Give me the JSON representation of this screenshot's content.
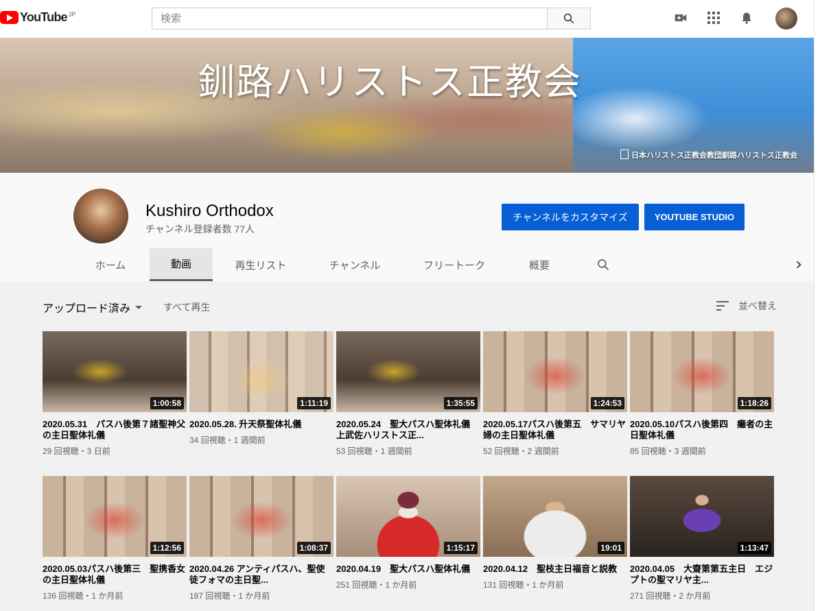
{
  "header": {
    "logo_text": "YouTube",
    "region": "JP",
    "search_placeholder": "検索"
  },
  "banner": {
    "title": "釧路ハリストス正教会",
    "credit": "日本ハリストス正教会教団釧路ハリストス正教会"
  },
  "channel": {
    "name": "Kushiro Orthodox",
    "subscribers": "チャンネル登録者数 77人",
    "customize_label": "チャンネルをカスタマイズ",
    "studio_label": "YOUTUBE STUDIO"
  },
  "tabs": [
    {
      "label": "ホーム"
    },
    {
      "label": "動画"
    },
    {
      "label": "再生リスト"
    },
    {
      "label": "チャンネル"
    },
    {
      "label": "フリートーク"
    },
    {
      "label": "概要"
    }
  ],
  "active_tab": "動画",
  "toolbar": {
    "dropdown_label": "アップロード済み",
    "play_all_label": "すべて再生",
    "sort_label": "並べ替え"
  },
  "videos": [
    {
      "title": "2020.05.31　パスハ後第７諸聖神父の主日聖体礼儀",
      "meta": "29 回視聴・3 日前",
      "duration": "1:00:58",
      "thumb": "gold"
    },
    {
      "title": "2020.05.28. 升天祭聖体礼儀",
      "meta": "34 回視聴・1 週間前",
      "duration": "1:11:19",
      "thumb": "warm"
    },
    {
      "title": "2020.05.24　聖大パスハ聖体礼儀　上武佐ハリストス正...",
      "meta": "53 回視聴・1 週間前",
      "duration": "1:35:55",
      "thumb": "gold"
    },
    {
      "title": "2020.05.17パスハ後第五　サマリヤ婦の主日聖体礼儀",
      "meta": "52 回視聴・2 週間前",
      "duration": "1:24:53",
      "thumb": "red"
    },
    {
      "title": "2020.05.10パスハ後第四　癱者の主日聖体礼儀",
      "meta": "85 回視聴・3 週間前",
      "duration": "1:18:26",
      "thumb": "red"
    },
    {
      "title": "2020.05.03パスハ後第三　聖携香女の主日聖体礼儀",
      "meta": "136 回視聴・1 か月前",
      "duration": "1:12:56",
      "thumb": "red"
    },
    {
      "title": "2020.04.26 アンティパスハ、聖使徒フォマの主日聖...",
      "meta": "187 回視聴・1 か月前",
      "duration": "1:08:37",
      "thumb": "red"
    },
    {
      "title": "2020.04.19　聖大パスハ聖体礼儀",
      "meta": "251 回視聴・1 か月前",
      "duration": "1:15:17",
      "thumb": "priest"
    },
    {
      "title": "2020.04.12　聖枝主日福音と説教",
      "meta": "131 回視聴・1 か月前",
      "duration": "19:01",
      "thumb": "white"
    },
    {
      "title": "2020.04.05　大齋第第五主日　エジプトの聖マリヤ主...",
      "meta": "271 回視聴・2 か月前",
      "duration": "1:13:47",
      "thumb": "purple"
    }
  ],
  "colors": {
    "brand_red": "#ff0000",
    "button_blue": "#065fd4"
  }
}
